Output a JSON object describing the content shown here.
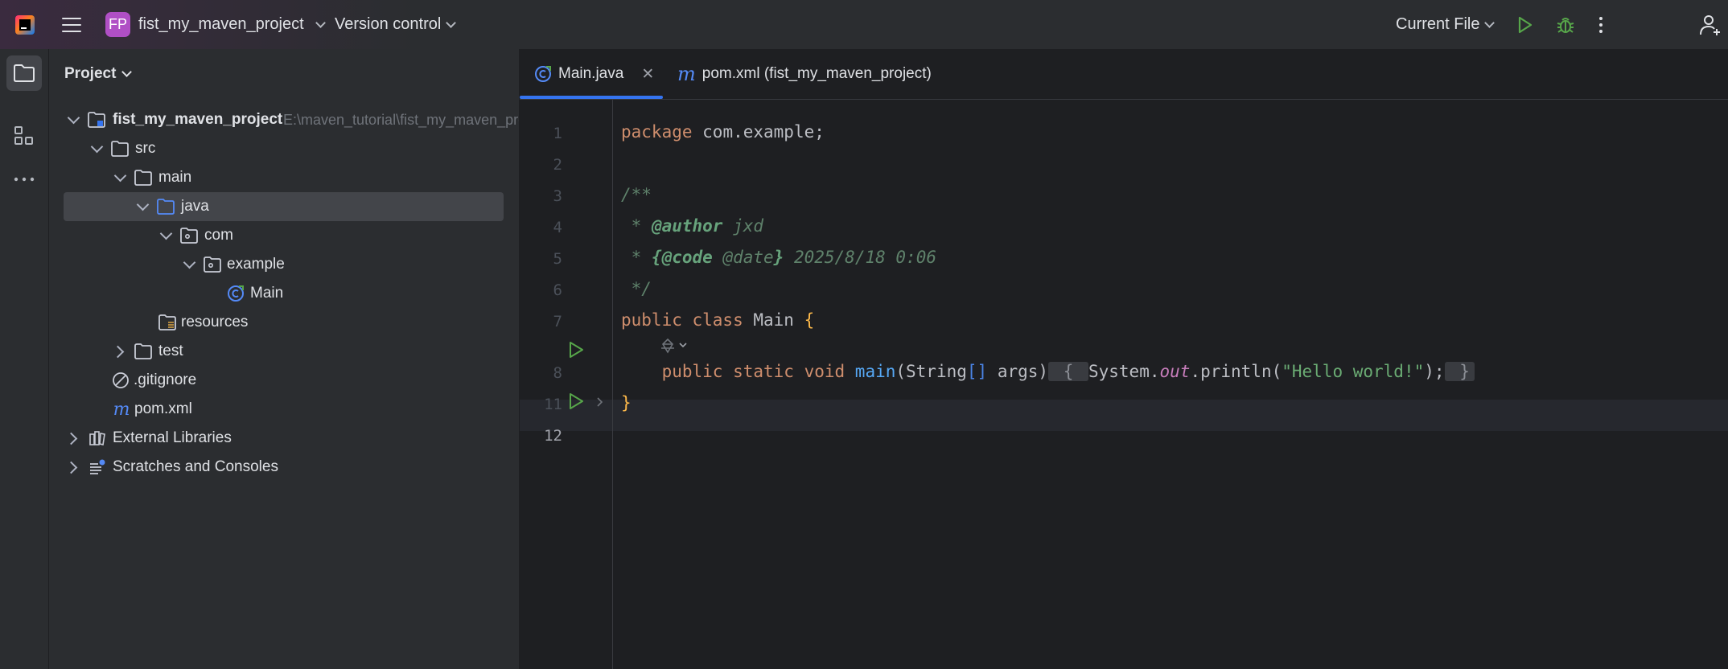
{
  "topbar": {
    "project_badge": "FP",
    "project_name": "fist_my_maven_project",
    "vcs_label": "Version control",
    "run_config": "Current File"
  },
  "project_panel": {
    "title": "Project",
    "tree": [
      {
        "label": "fist_my_maven_project",
        "hint": "E:\\maven_tutorial\\fist_my_maven_project"
      },
      {
        "label": "src"
      },
      {
        "label": "main"
      },
      {
        "label": "java"
      },
      {
        "label": "com"
      },
      {
        "label": "example"
      },
      {
        "label": "Main"
      },
      {
        "label": "resources"
      },
      {
        "label": "test"
      },
      {
        "label": ".gitignore"
      },
      {
        "label": "pom.xml"
      },
      {
        "label": "External Libraries"
      },
      {
        "label": "Scratches and Consoles"
      }
    ]
  },
  "editor": {
    "tabs": [
      {
        "label": "Main.java"
      },
      {
        "label": "pom.xml (fist_my_maven_project)"
      }
    ],
    "line_numbers": [
      "1",
      "2",
      "3",
      "4",
      "5",
      "6",
      "7",
      "8",
      "11",
      "12"
    ],
    "code": {
      "l1_kw": "package",
      "l1_rest": " com.example;",
      "l3": "/**",
      "l4_star": " * ",
      "l4_tag": "@author",
      "l4_rest": " jxd",
      "l5_star": " * ",
      "l5_open": "{@code ",
      "l5_tag": "@date",
      "l5_close": "}",
      "l5_rest": " 2025/8/18 0:06",
      "l6": " */",
      "l7_kw": "public class",
      "l7_name": " Main ",
      "l7_brace": "{",
      "l8_indent": "    ",
      "l8_kw": "public static void",
      "l8_fn": " main",
      "l8_paren_open": "(String",
      "l8_brackets": "[]",
      "l8_args": " args)",
      "l8_fold_open": " { ",
      "l8_sys": "System.",
      "l8_out": "out",
      "l8_println": ".println(",
      "l8_str": "\"Hello world!\"",
      "l8_end": ");",
      "l8_fold_close": " }",
      "l11": "}"
    }
  }
}
